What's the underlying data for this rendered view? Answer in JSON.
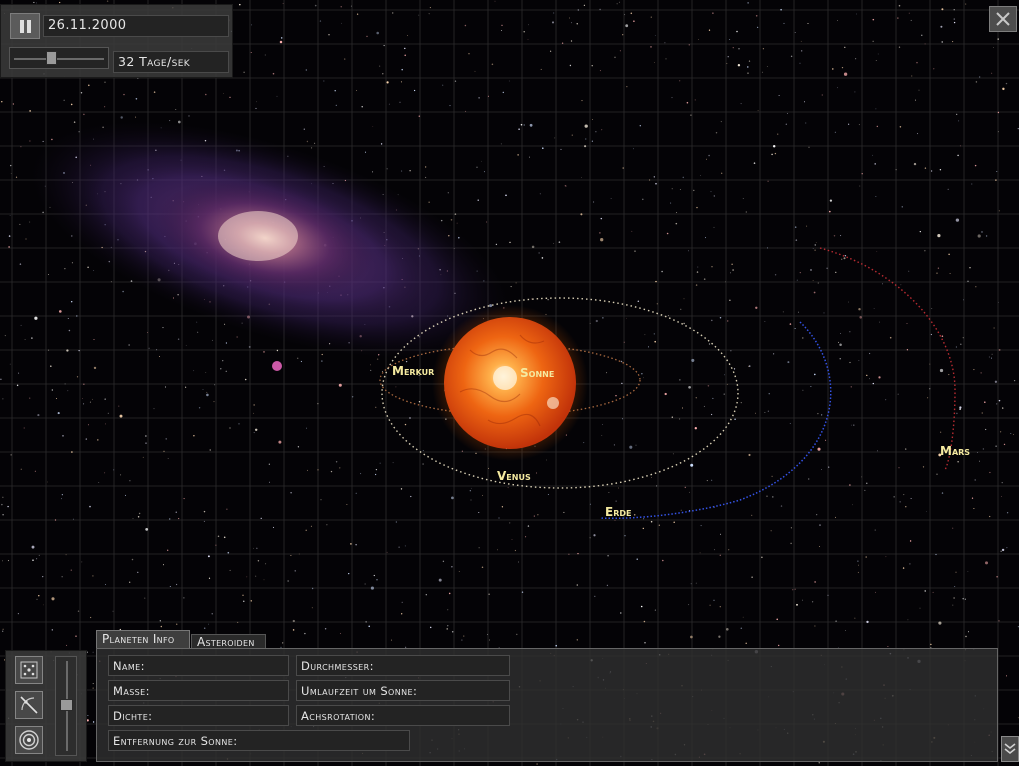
{
  "controls": {
    "date": "26.11.2000",
    "speed_label": "32 Tage/sek",
    "speed_fraction": 0.4
  },
  "tabs": {
    "planet_info": "Planeten Info",
    "asteroids": "Asteroiden"
  },
  "zoom_fraction": 0.48,
  "bodies": {
    "sun": "Sonne",
    "mercury": "Merkur",
    "venus": "Venus",
    "earth": "Erde",
    "mars": "Mars"
  },
  "info": {
    "name": "Name:",
    "mass": "Masse:",
    "density": "Dichte:",
    "distance": "Entfernung zur Sonne:",
    "diameter": "Durchmesser:",
    "orbital_period": "Umlaufzeit um Sonne:",
    "axis_rotation": "Achsrotation:"
  },
  "icons": {
    "pause": "pause-icon",
    "close": "close-icon",
    "scroll_down": "double-chevron-down-icon",
    "tool_1": "asteroid-field-icon",
    "tool_2": "orbit-lines-icon",
    "tool_3": "target-icon"
  },
  "colors": {
    "sun": "#e85a10",
    "label": "#f5eaa0",
    "mercury_orbit": "#c77b4a",
    "venus_orbit": "#f0e6c8",
    "earth_orbit": "#3a5cff",
    "mars_orbit": "#d8333a"
  }
}
